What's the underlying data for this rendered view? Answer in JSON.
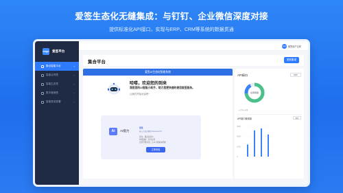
{
  "banner": {
    "title": "爱签生态化无缝集成：与钉钉、企业微信深度对接",
    "subtitle": "提供标准化API接口，实现与ERP、CRM等系统的数据贯通"
  },
  "brand": {
    "logo": "esign",
    "name": "爱签平台"
  },
  "sidebar": {
    "items": [
      {
        "label": "集合智能平台",
        "active": true
      },
      {
        "label": "智能合同签",
        "active": false
      },
      {
        "label": "智能生态签",
        "active": false
      },
      {
        "label": "数字营销签",
        "active": false
      },
      {
        "label": "智能签成签署",
        "active": false
      }
    ]
  },
  "topbar": {
    "avatar": "esign",
    "user": "爱签用户名称"
  },
  "page": {
    "title": "集合平台",
    "button": "更新集成"
  },
  "assistant": {
    "bar_title": "爱签AI生态化智能系统",
    "hello": "哈喽，欢迎您的到来",
    "intro": "我是您的AI智能小助手，助力您更快速的使用爱签服务。",
    "prompt": "让我们开始对话吧~",
    "card": {
      "icon": "Ai",
      "name": "AI能力",
      "tag": "爱签",
      "model": "接入大语言模型 DeepseekV3",
      "line1": "您好，我是爱签AI",
      "line2": "智能辅助，有问必答",
      "line3": "立即开始对话，让AI为您解决问题",
      "button": "立即体验"
    }
  },
  "api_panel": {
    "title": "API接口",
    "select": "ERP",
    "donut_label": "总调用量",
    "legend": "● 已用   ● 未用",
    "bars_title": "API接口使用量",
    "bars_select": "本月"
  },
  "chart_data": {
    "type": "bar",
    "y_ticks": [
      "3000",
      "2000",
      "1000",
      "0"
    ],
    "values": [
      1200,
      2600,
      2800,
      2200
    ]
  },
  "colors": {
    "accent": "#2f7bff",
    "sidebar": "#1f2a44",
    "banner": "#1f6fee"
  }
}
